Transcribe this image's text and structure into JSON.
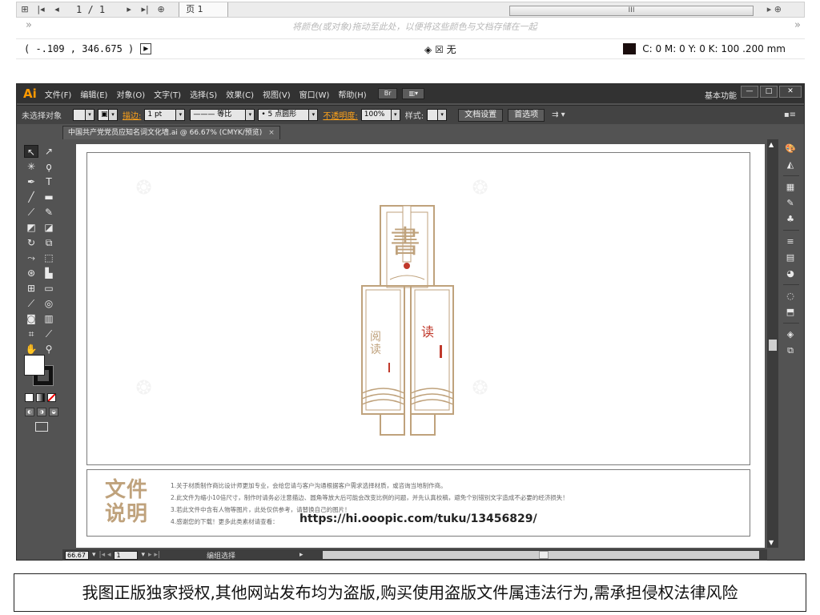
{
  "top_strip": {
    "page_index": "1 / 1",
    "page_tab_label": "页 1",
    "scroll_label": "III",
    "hint_text": "将颜色(或对象)拖动至此处，以便将这些颜色与文档存储在一起",
    "coordinates": "( -.109 , 346.675 )",
    "fill_none_label": "无",
    "cmyk_readout": "C: 0 M: 0 Y: 0 K: 100  .200 mm"
  },
  "menubar": {
    "logo": "Ai",
    "items": [
      "文件(F)",
      "编辑(E)",
      "对象(O)",
      "文字(T)",
      "选择(S)",
      "效果(C)",
      "视图(V)",
      "窗口(W)",
      "帮助(H)"
    ],
    "br_badge": "Br",
    "workspace": "基本功能",
    "win_controls": [
      "—",
      "□",
      "✕"
    ]
  },
  "control_bar": {
    "selection_label": "未选择对象",
    "stroke_label": "描边:",
    "stroke_value": "1 pt",
    "stroke_profile": "等比",
    "brush_value": "5 点圆形",
    "opacity_label": "不透明度:",
    "opacity_value": "100%",
    "style_label": "样式:",
    "doc_setup_button": "文档设置",
    "preferences_button": "首选项"
  },
  "document": {
    "tab_title": "中国共产党党员应知名词文化墙.ai @ 66.67% (CMYK/预览)",
    "close": "×"
  },
  "notes": {
    "title_line1": "文件",
    "title_line2": "说明",
    "lines": [
      "1.关于材质制作商比设计师更加专业，会给您请与客户沟通根据客户需求选择材质，或咨询当地制作商。",
      "2.此文件为缩小10倍尺寸，制作时请务必注意描边、圆角等放大后可能会改变比例的问题，并先认真校稿，避免个别错别文字造成不必要的经济损失！",
      "3.若此文件中含有人物等图片，此处仅供参考，请替换自己的图片！",
      "4.感谢您的下载！更多此类素材请查看："
    ],
    "url": "https://hi.ooopic.com/tuku/13456829/"
  },
  "artwork": {
    "calligraphy_top": "書",
    "calligraphy_left": "阅读",
    "calligraphy_right": "读"
  },
  "statusbar": {
    "zoom": "66.67",
    "page": "1",
    "mode_label": "编组选择"
  },
  "notice": "我图正版独家授权,其他网站发布均为盗版,购买使用盗版文件属违法行为,需承担侵权法律风险",
  "colors": {
    "gold": "#bfa27c",
    "ai_orange": "#ff9a00",
    "panel_dark": "#323232",
    "panel_mid": "#535353"
  }
}
